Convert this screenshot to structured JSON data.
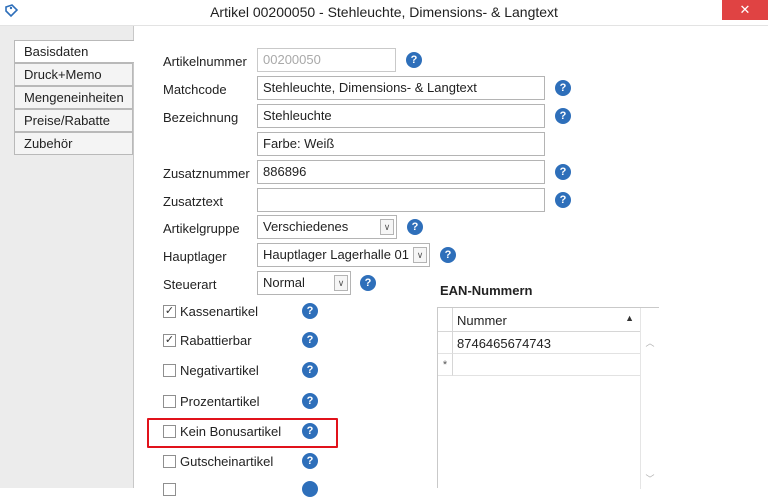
{
  "window": {
    "title": "Artikel 00200050 - Stehleuchte, Dimensions- & Langtext",
    "close_label": "✕",
    "app_icon": "tag-icon"
  },
  "nav": {
    "items": [
      {
        "label": "Basisdaten",
        "active": true
      },
      {
        "label": "Druck+Memo",
        "active": false
      },
      {
        "label": "Mengeneinheiten",
        "active": false
      },
      {
        "label": "Preise/Rabatte",
        "active": false
      },
      {
        "label": "Zubehör",
        "active": false
      }
    ]
  },
  "form": {
    "artikelnummer": {
      "label": "Artikelnummer",
      "value": "00200050"
    },
    "matchcode": {
      "label": "Matchcode",
      "value": "Stehleuchte, Dimensions- & Langtext"
    },
    "bezeichnung": {
      "label": "Bezeichnung",
      "value": "Stehleuchte",
      "value2": "Farbe: Weiß"
    },
    "zusatznummer": {
      "label": "Zusatznummer",
      "value": "886896"
    },
    "zusatztext": {
      "label": "Zusatztext",
      "value": ""
    },
    "artikelgruppe": {
      "label": "Artikelgruppe",
      "value": "Verschiedenes"
    },
    "hauptlager": {
      "label": "Hauptlager",
      "value": "Hauptlager Lagerhalle 01"
    },
    "steuerart": {
      "label": "Steuerart",
      "value": "Normal"
    },
    "help_glyph": "?",
    "combo_glyph": "∨",
    "check_glyph": "✓"
  },
  "checkboxes": [
    {
      "label": "Kassenartikel",
      "checked": true
    },
    {
      "label": "Rabattierbar",
      "checked": true
    },
    {
      "label": "Negativartikel",
      "checked": false
    },
    {
      "label": "Prozentartikel",
      "checked": false
    },
    {
      "label": "Kein Bonusartikel",
      "checked": false
    },
    {
      "label": "Gutscheinartikel",
      "checked": false
    }
  ],
  "ean": {
    "title": "EAN-Nummern",
    "column": "Nummer",
    "rows": [
      "8746465674743"
    ],
    "new_row_marker": "*",
    "sort_glyph": "▲"
  },
  "colors": {
    "help_icon": "#2e6fba",
    "close_button": "#e04343",
    "highlight_box": "#e1121b"
  }
}
